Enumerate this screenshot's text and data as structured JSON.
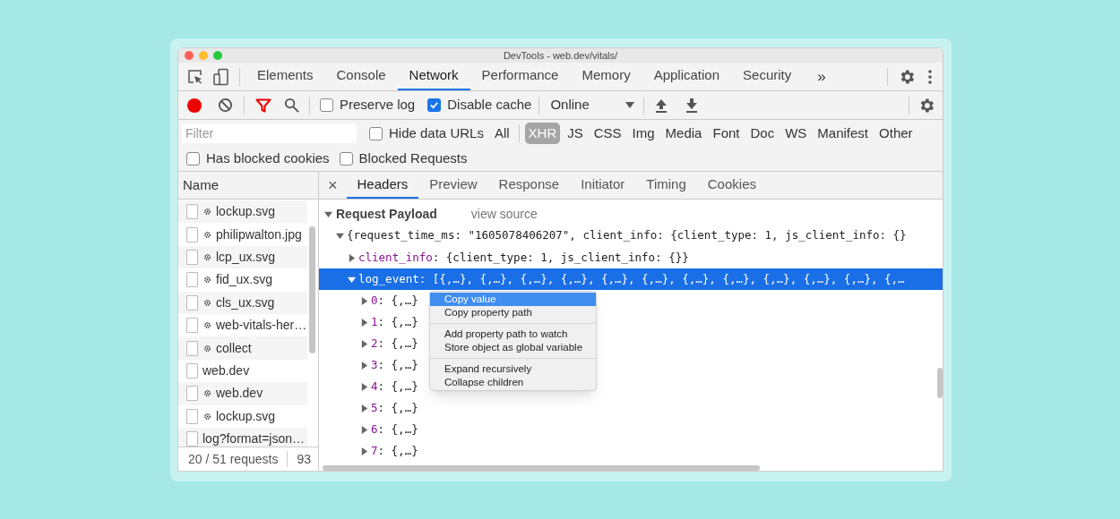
{
  "window": {
    "title": "DevTools - web.dev/vitals/"
  },
  "main_tabs": [
    {
      "label": "Elements",
      "selected": false
    },
    {
      "label": "Console",
      "selected": false
    },
    {
      "label": "Network",
      "selected": true
    },
    {
      "label": "Performance",
      "selected": false
    },
    {
      "label": "Memory",
      "selected": false
    },
    {
      "label": "Application",
      "selected": false
    },
    {
      "label": "Security",
      "selected": false
    }
  ],
  "more_tabs": "»",
  "toolbar": {
    "preserve_log": {
      "label": "Preserve log",
      "checked": false
    },
    "disable_cache": {
      "label": "Disable cache",
      "checked": true
    },
    "throttling": "Online"
  },
  "filter_bar": {
    "placeholder": "Filter",
    "hide_data_urls": {
      "label": "Hide data URLs",
      "checked": false
    },
    "types": [
      {
        "label": "All",
        "selected": false
      },
      {
        "label": "XHR",
        "selected": true
      },
      {
        "label": "JS",
        "selected": false
      },
      {
        "label": "CSS",
        "selected": false
      },
      {
        "label": "Img",
        "selected": false
      },
      {
        "label": "Media",
        "selected": false
      },
      {
        "label": "Font",
        "selected": false
      },
      {
        "label": "Doc",
        "selected": false
      },
      {
        "label": "WS",
        "selected": false
      },
      {
        "label": "Manifest",
        "selected": false
      },
      {
        "label": "Other",
        "selected": false
      }
    ],
    "has_blocked_cookies": {
      "label": "Has blocked cookies",
      "checked": false
    },
    "blocked_requests": {
      "label": "Blocked Requests",
      "checked": false
    }
  },
  "requests": {
    "column": "Name",
    "rows": [
      {
        "name": "lockup.svg",
        "kind": "service_worker"
      },
      {
        "name": "philipwalton.jpg",
        "kind": "service_worker"
      },
      {
        "name": "lcp_ux.svg",
        "kind": "service_worker"
      },
      {
        "name": "fid_ux.svg",
        "kind": "service_worker"
      },
      {
        "name": "cls_ux.svg",
        "kind": "service_worker"
      },
      {
        "name": "web-vitals-her…",
        "kind": "service_worker"
      },
      {
        "name": "collect",
        "kind": "service_worker"
      },
      {
        "name": "web.dev",
        "kind": "network"
      },
      {
        "name": "web.dev",
        "kind": "service_worker"
      },
      {
        "name": "lockup.svg",
        "kind": "service_worker"
      },
      {
        "name": "log?format=json…",
        "kind": "network"
      }
    ],
    "summary": "20 / 51 requests",
    "transferred": "93"
  },
  "detail": {
    "close": "×",
    "tabs": [
      {
        "label": "Headers",
        "selected": true
      },
      {
        "label": "Preview",
        "selected": false
      },
      {
        "label": "Response",
        "selected": false
      },
      {
        "label": "Initiator",
        "selected": false
      },
      {
        "label": "Timing",
        "selected": false
      },
      {
        "label": "Cookies",
        "selected": false
      }
    ],
    "section": {
      "title": "Request Payload",
      "link": "view source",
      "expanded": true
    },
    "tree": {
      "text": "{request_time_ms: \"1605078406207\", client_info: {client_type: 1, js_client_info: {}",
      "expanded": true,
      "children": [
        {
          "key": "client_info",
          "value": ": {client_type: 1, js_client_info: {}}",
          "expanded": false,
          "selected": false
        },
        {
          "key": "log_event",
          "value": ": [{,…}, {,…}, {,…}, {,…}, {,…}, {,…}, {,…}, {,…}, {,…}, {,…}, {,…}, {,…",
          "expanded": true,
          "selected": true,
          "children": [
            {
              "key": "0",
              "value": ": {,…}"
            },
            {
              "key": "1",
              "value": ": {,…}"
            },
            {
              "key": "2",
              "value": ": {,…}"
            },
            {
              "key": "3",
              "value": ": {,…}"
            },
            {
              "key": "4",
              "value": ": {,…}"
            },
            {
              "key": "5",
              "value": ": {,…}"
            },
            {
              "key": "6",
              "value": ": {,…}"
            },
            {
              "key": "7",
              "value": ": {,…}"
            }
          ]
        }
      ]
    }
  },
  "context_menu": {
    "groups": [
      [
        {
          "label": "Copy value",
          "selected": true
        },
        {
          "label": "Copy property path",
          "selected": false
        }
      ],
      [
        {
          "label": "Add property path to watch",
          "selected": false
        },
        {
          "label": "Store object as global variable",
          "selected": false
        }
      ],
      [
        {
          "label": "Expand recursively",
          "selected": false
        },
        {
          "label": "Collapse children",
          "selected": false
        }
      ]
    ]
  }
}
